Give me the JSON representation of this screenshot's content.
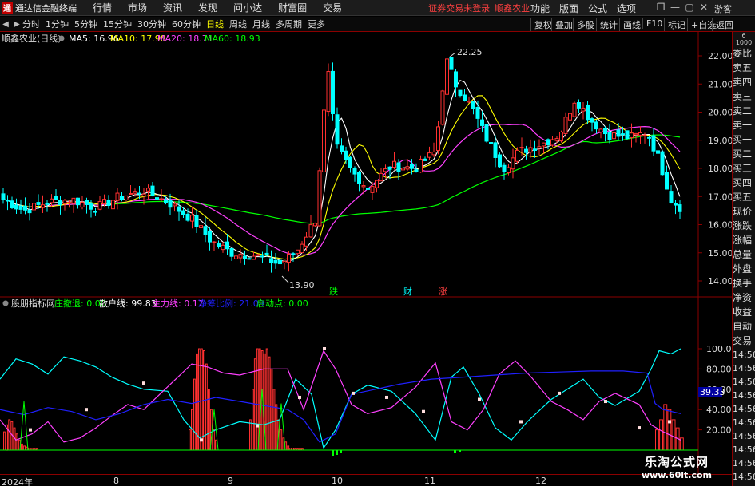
{
  "app": {
    "title": "通达信金融终端",
    "logo_char": "通",
    "menus": [
      "行情",
      "市场",
      "资讯",
      "发现",
      "问小达",
      "财富圈",
      "交易"
    ],
    "warning": "证券交易未登录",
    "stock_name": "顺鑫农业",
    "right_menus": [
      "功能",
      "版面",
      "公式",
      "选项"
    ],
    "window_buttons": [
      "❐",
      "—",
      "▢",
      "✕"
    ],
    "guest": "游客"
  },
  "toolbar": {
    "nav_left": "◀",
    "nav_right": "▶",
    "periods": [
      "分时",
      "1分钟",
      "5分钟",
      "15分钟",
      "30分钟",
      "60分钟",
      "日线",
      "周线",
      "月线",
      "多周期",
      "更多"
    ],
    "active_period": "日线",
    "buttons": [
      "复权",
      "叠加",
      "多股",
      "统计",
      "画线",
      "F10",
      "标记",
      "+自选",
      "返回"
    ]
  },
  "price_chart": {
    "title": "顺鑫农业(日线)",
    "ma_labels": [
      {
        "text": "MA5: 16.96",
        "color": "#ffffff"
      },
      {
        "text": "MA10: 17.98",
        "color": "#ffff00"
      },
      {
        "text": "MA20: 18.71",
        "color": "#ff40ff"
      },
      {
        "text": "MA60: 18.93",
        "color": "#00ff00"
      }
    ],
    "y_ticks": [
      "22.00",
      "21.00",
      "20.00",
      "19.00",
      "18.00",
      "17.00",
      "16.00",
      "15.00",
      "14.00"
    ],
    "high_label": "22.25",
    "low_label": "13.90",
    "event_markers": [
      {
        "text": "跌",
        "color": "#00ff00"
      },
      {
        "text": "财",
        "color": "#00ffff"
      },
      {
        "text": "涨",
        "color": "#ff4040"
      }
    ]
  },
  "indicator": {
    "name": "股朋指标网",
    "items": [
      {
        "text": "庄撤退: 0.00",
        "color": "#00ff00"
      },
      {
        "text": "散户线: 99.83",
        "color": "#ffffff"
      },
      {
        "text": "主力线: 0.17",
        "color": "#ff40ff"
      },
      {
        "text": "净筹比例: 21.09",
        "color": "#2020ff"
      },
      {
        "text": "启动点: 0.00",
        "color": "#00ff00"
      }
    ],
    "y_ticks": [
      "100.00",
      "80.00",
      "60.00",
      "40.00",
      "20.00"
    ],
    "current_value": "39.33"
  },
  "x_axis": [
    "2024年",
    "8",
    "9",
    "10",
    "11",
    "12"
  ],
  "side_panel": {
    "top_labels": [
      "6",
      "1000"
    ],
    "items": [
      "委比",
      "卖五",
      "卖四",
      "卖三",
      "卖二",
      "卖一",
      "买一",
      "买二",
      "买三",
      "买四",
      "买五",
      "现价",
      "涨跌",
      "涨幅",
      "总量",
      "外盘",
      "换手",
      "净资",
      "收益",
      "自动",
      "交易"
    ],
    "times": [
      "14:56",
      "14:56",
      "14:56",
      "14:56",
      "14:56",
      "14:56",
      "14:56",
      "14:56",
      "14:56",
      "14:56"
    ]
  },
  "watermark": {
    "title": "乐淘公式网",
    "url": "www.60lt.com"
  },
  "colors": {
    "up": "#ff3030",
    "down": "#00ffff",
    "ma5": "#ffffff",
    "ma10": "#ffff00",
    "ma20": "#ff40ff",
    "ma60": "#00ff00",
    "axis": "#8b0000",
    "retail_line": "#00ffff",
    "main_line": "#ff40ff",
    "chip_line": "#2020ff"
  }
}
